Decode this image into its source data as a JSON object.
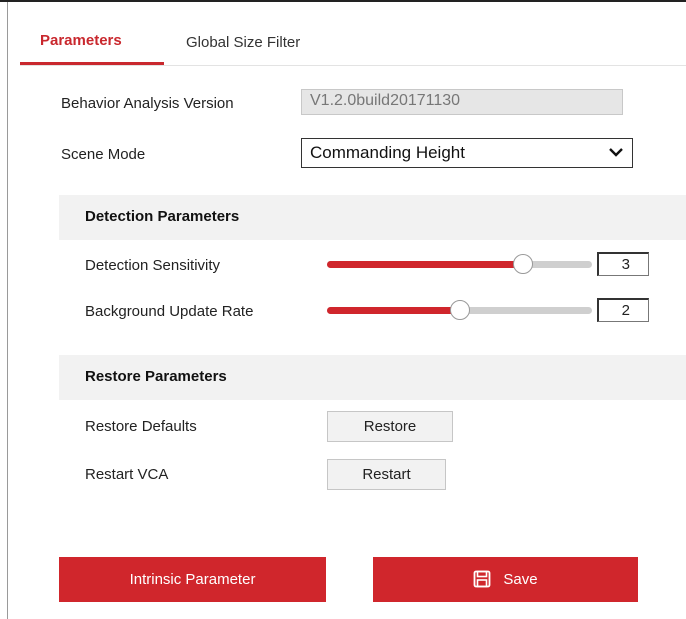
{
  "tabs": {
    "active": "Parameters",
    "inactive": "Global Size Filter"
  },
  "settings": {
    "version_label": "Behavior Analysis Version",
    "version_value": "V1.2.0build20171130",
    "scene_mode_label": "Scene Mode",
    "scene_mode_value": "Commanding Height"
  },
  "detection": {
    "title": "Detection Parameters",
    "sensitivity_label": "Detection Sensitivity",
    "sensitivity_value": "3",
    "sensitivity_fraction": 0.74,
    "update_rate_label": "Background Update Rate",
    "update_rate_value": "2",
    "update_rate_fraction": 0.5
  },
  "restore": {
    "title": "Restore Parameters",
    "defaults_label": "Restore Defaults",
    "defaults_button": "Restore",
    "restart_label": "Restart VCA",
    "restart_button": "Restart"
  },
  "footer": {
    "intrinsic_button": "Intrinsic Parameter",
    "save_button": "Save"
  },
  "icons": {
    "scene_mode_dropdown": "chevron-down-icon",
    "save": "save-icon"
  },
  "colors": {
    "accent": "#d0262c",
    "tab_active": "#c9282e",
    "section_bg": "#f2f2f2"
  }
}
